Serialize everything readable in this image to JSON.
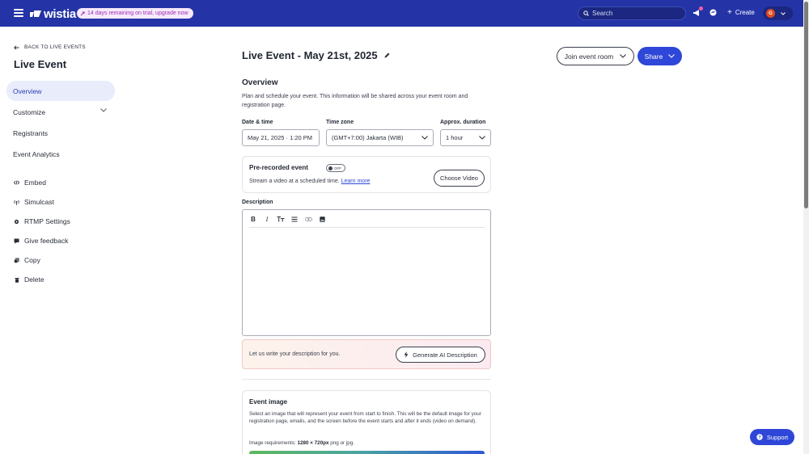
{
  "topbar": {
    "logo_text": "wistia",
    "trial_banner": "14 days remaining on trial, upgrade now",
    "search_placeholder": "Search",
    "create_label": "Create",
    "avatar_initial": "G"
  },
  "sidebar": {
    "back_label": "BACK TO LIVE EVENTS",
    "title": "Live Event",
    "primary": [
      {
        "label": "Overview",
        "active": true
      },
      {
        "label": "Customize",
        "expandable": true
      },
      {
        "label": "Registrants"
      },
      {
        "label": "Event Analytics"
      }
    ],
    "secondary": [
      {
        "label": "Embed",
        "icon": "code-icon"
      },
      {
        "label": "Simulcast",
        "icon": "broadcast-icon"
      },
      {
        "label": "RTMP Settings",
        "icon": "gear-icon"
      },
      {
        "label": "Give feedback",
        "icon": "feedback-icon"
      },
      {
        "label": "Copy",
        "icon": "copy-icon"
      },
      {
        "label": "Delete",
        "icon": "trash-icon"
      }
    ]
  },
  "header": {
    "title": "Live Event - May 21st, 2025",
    "join_label": "Join event room",
    "share_label": "Share"
  },
  "overview": {
    "title": "Overview",
    "description": "Plan and schedule your event. This information will be shared across your event room and registration page.",
    "date_label": "Date & time",
    "date_value": "May 21, 2025 · 1:20 PM",
    "timezone_label": "Time zone",
    "timezone_value": "(GMT+7:00) Jakarta (WIB)",
    "duration_label": "Approx. duration",
    "duration_value": "1 hour"
  },
  "prerecorded": {
    "title": "Pre-recorded event",
    "toggle_label": "OFF",
    "description": "Stream a video at a scheduled time.",
    "learn_more": "Learn more",
    "choose_label": "Choose Video"
  },
  "description_editor": {
    "label": "Description",
    "ai_prompt": "Let us write your description for you.",
    "ai_button": "Generate AI Description"
  },
  "event_image": {
    "title": "Event image",
    "description": "Select an image that will represent your event from start to finish. This will be the default image for your registration page, emails, and the screen before the event starts and after it ends (video on demand).",
    "req_prefix": "Image requirements:",
    "req_size": "1280 × 720px",
    "req_suffix": "png or jpg."
  },
  "support_label": "Support",
  "colors": {
    "topbar": "#2434a6",
    "accent": "#2e47d8",
    "active_nav_bg": "#e8ecfb"
  }
}
